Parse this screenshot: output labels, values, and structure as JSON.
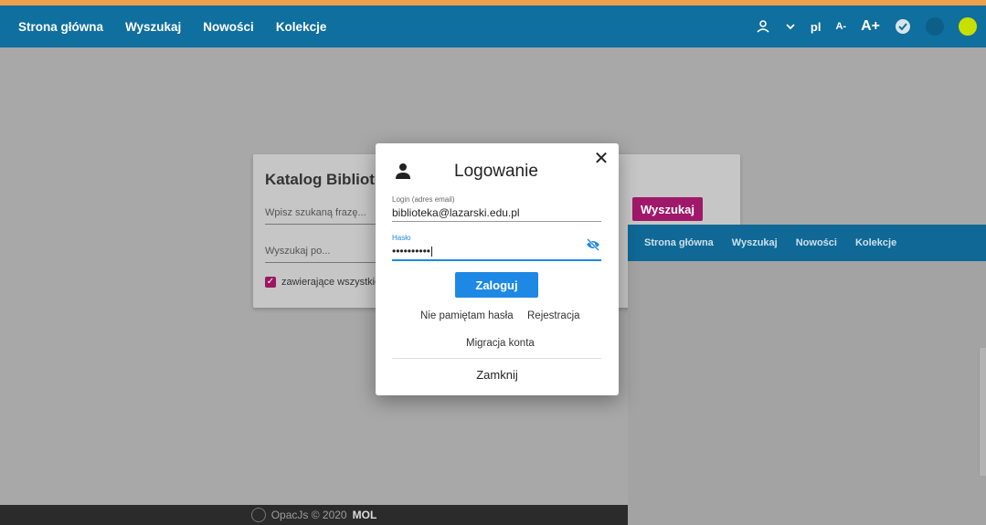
{
  "nav": {
    "items": [
      "Strona główna",
      "Wyszukaj",
      "Nowości",
      "Kolekcje"
    ]
  },
  "tools": {
    "lang": "pl",
    "font_smaller": "A-",
    "font_bigger": "A+"
  },
  "colors": {
    "header": "#0f6f9e",
    "accent_orange": "#f0a04b",
    "search_button": "#a01869",
    "login_button": "#1e88e5",
    "theme_blue": "#0d5f8a",
    "theme_yellow": "#c8e000"
  },
  "card": {
    "title": "Katalog Bibliot",
    "search_placeholder": "Wpisz szukaną frazę...",
    "search_by": "Wyszukaj po...",
    "checkbox_label": "zawierające wszystkie",
    "search_button": "Wyszukaj"
  },
  "nav2": {
    "items": [
      "Strona główna",
      "Wyszukaj",
      "Nowości",
      "Kolekcje"
    ]
  },
  "footer": {
    "text": "OpacJs © 2020",
    "brand": "MOL"
  },
  "modal": {
    "title": "Logowanie",
    "login_label": "Login (adres email)",
    "login_value": "biblioteka@lazarski.edu.pl",
    "password_label": "Hasło",
    "password_value": "••••••••••",
    "login_button": "Zaloguj",
    "forgot": "Nie pamiętam hasła",
    "register": "Rejestracja",
    "migrate": "Migracja konta",
    "close": "Zamknij"
  }
}
